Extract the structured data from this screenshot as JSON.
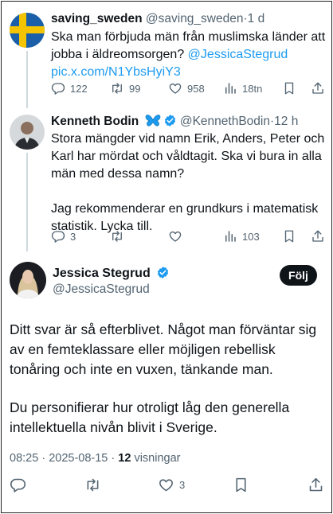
{
  "tweet1": {
    "display_name": "saving_sweden",
    "handle": "@saving_sweden",
    "separator": "·",
    "time": "1 d",
    "line1": "Ska man förbjuda män från muslimska länder att",
    "line2_text": "jobba i äldreomsorgen? ",
    "line2_mention": "@JessicaStegrud",
    "link": "pic.x.com/N1YbsHyiY3",
    "replies": "122",
    "retweets": "99",
    "likes": "958",
    "views": "18tn"
  },
  "tweet2": {
    "display_name": "Kenneth Bodin",
    "emoji": "🦋",
    "handle": "@KennethBodin",
    "separator": "·",
    "time": "12 h",
    "para1_l1": "Stora mängder vid namn Erik, Anders, Peter och",
    "para1_l2": "Karl har mördat och våldtagit. Ska vi bura in alla",
    "para1_l3": "män med dessa namn?",
    "para2_l1": "Jag rekommenderar en grundkurs i matematisk",
    "para2_l2": "statistik. Lycka till.",
    "replies": "3",
    "views": "103"
  },
  "main": {
    "display_name": "Jessica Stegrud",
    "handle": "@JessicaStegrud",
    "follow_label": "Följ",
    "para1_l1": "Ditt svar är så efterblivet. Något man förväntar sig",
    "para1_l2": "av en femteklassare eller möjligen rebellisk",
    "para1_l3": "tonåring och inte en vuxen, tänkande man.",
    "para2_l1": "Du personifierar hur otroligt låg den generella",
    "para2_l2": "intellektuella nivån blivit i Sverige.",
    "time": "08:25",
    "separator": "·",
    "date": "2025-08-15",
    "view_count": "12",
    "view_label": "visningar",
    "likes": "3"
  },
  "colors": {
    "text": "#0f1419",
    "secondary": "#536471",
    "accent": "#1d9bf0",
    "verified": "#1d9bf0",
    "follow_bg": "#0f1419"
  },
  "icons": [
    "reply-icon",
    "retweet-icon",
    "like-icon",
    "views-icon",
    "bookmark-icon",
    "share-icon",
    "verified-badge-icon"
  ]
}
